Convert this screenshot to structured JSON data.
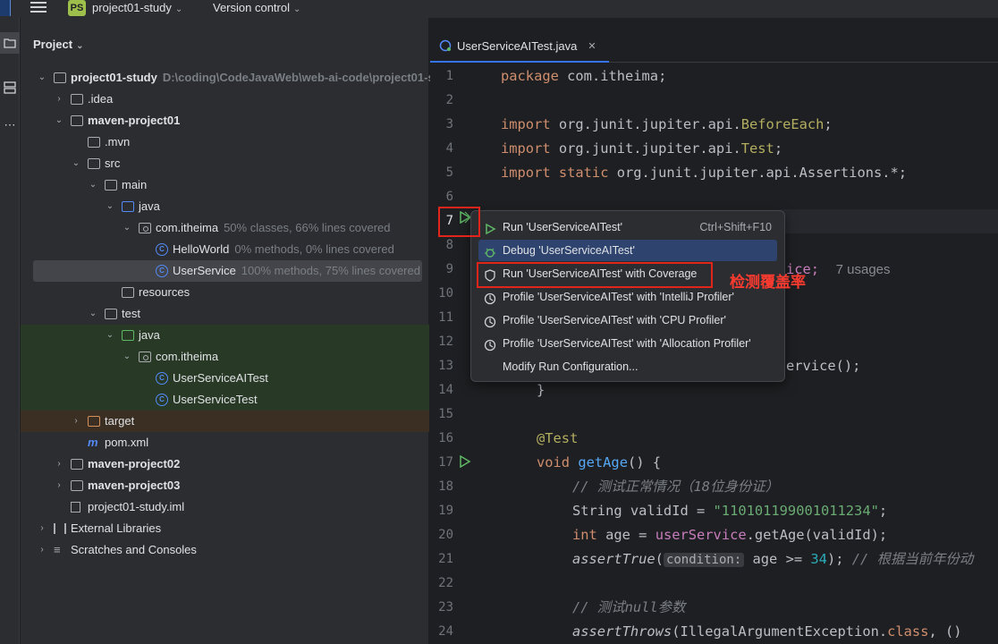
{
  "titlebar": {
    "project": "project01-study",
    "version_control": "Version control",
    "ide_badge": "PS"
  },
  "project_panel": {
    "title": "Project",
    "tree": [
      {
        "label": "project01-study",
        "note": "D:\\coding\\CodeJavaWeb\\web-ai-code\\project01-st",
        "bold": true
      },
      {
        "label": ".idea"
      },
      {
        "label": "maven-project01",
        "bold": true
      },
      {
        "label": ".mvn"
      },
      {
        "label": "src"
      },
      {
        "label": "main"
      },
      {
        "label": "java"
      },
      {
        "label": "com.itheima",
        "note": "50% classes, 66% lines covered"
      },
      {
        "label": "HelloWorld",
        "note": "0% methods, 0% lines covered"
      },
      {
        "label": "UserService",
        "note": "100% methods, 75% lines covered"
      },
      {
        "label": "resources"
      },
      {
        "label": "test"
      },
      {
        "label": "java"
      },
      {
        "label": "com.itheima"
      },
      {
        "label": "UserServiceAITest"
      },
      {
        "label": "UserServiceTest"
      },
      {
        "label": "target"
      },
      {
        "label": "pom.xml"
      },
      {
        "label": "maven-project02",
        "bold": true
      },
      {
        "label": "maven-project03",
        "bold": true
      },
      {
        "label": "project01-study.iml"
      },
      {
        "label": "External Libraries"
      },
      {
        "label": "Scratches and Consoles"
      }
    ]
  },
  "editor": {
    "tab_label": "UserServiceAITest.java",
    "line_numbers": [
      "1",
      "2",
      "3",
      "4",
      "5",
      "6",
      "7",
      "8",
      "9",
      "10",
      "11",
      "12",
      "13",
      "14",
      "15",
      "16",
      "17",
      "18",
      "19",
      "20",
      "21",
      "22",
      "23",
      "24"
    ],
    "code": {
      "l1a": "package",
      "l1b": " com.itheima;",
      "l3a": "import",
      "l3b": " org.junit.jupiter.api.",
      "l3c": "BeforeEach",
      "l3d": ";",
      "l4a": "import",
      "l4b": " org.junit.jupiter.api.",
      "l4c": "Test",
      "l4d": ";",
      "l5a": "import static",
      "l5b": " org.junit.jupiter.api.Assertions.*;",
      "l9a": "ice;",
      "l9b": "7 usages",
      "l13a": "ervice();",
      "l14a": "}",
      "l16a": "@Test",
      "l17a": "void",
      "l17b": "getAge",
      "l17c": "() {",
      "l18a": "// 测试正常情况（18位身份证）",
      "l19a": "String validId = ",
      "l19b": "\"110101199001011234\"",
      "l19c": ";",
      "l20a": "int",
      "l20b": " age = ",
      "l20c": "userService",
      "l20d": ".getAge(validId);",
      "l21a": "assertTrue",
      "l21b": "(",
      "l21c": "condition:",
      "l21d": " age >= ",
      "l21e": "34",
      "l21f": "); ",
      "l21g": "// 根据当前年份动",
      "l23a": "// 测试null参数",
      "l24a": "assertThrows",
      "l24b": "(IllegalArgumentException.",
      "l24c": "class",
      "l24d": ", ()"
    }
  },
  "popup_menu": {
    "items": [
      {
        "label": "Run 'UserServiceAITest'",
        "shortcut": "Ctrl+Shift+F10"
      },
      {
        "label": "Debug 'UserServiceAITest'"
      },
      {
        "label": "Run 'UserServiceAITest' with Coverage"
      },
      {
        "label": "Profile 'UserServiceAITest' with 'IntelliJ Profiler'"
      },
      {
        "label": "Profile 'UserServiceAITest' with 'CPU Profiler'"
      },
      {
        "label": "Profile 'UserServiceAITest' with 'Allocation Profiler'"
      },
      {
        "label": "Modify Run Configuration..."
      }
    ]
  },
  "annotation": {
    "text": "检测覆盖率",
    "color": "#ff3b30"
  },
  "colors": {
    "accent": "#3574f0",
    "hover": "#2e436e",
    "red": "#e1251b"
  }
}
